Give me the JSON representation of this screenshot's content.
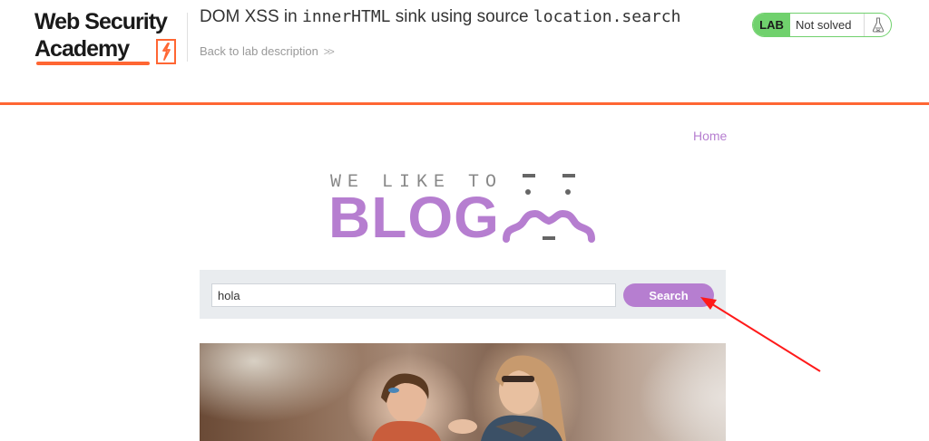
{
  "academy": {
    "logo_line1": "Web Security",
    "logo_line2": "Academy",
    "lab_title_prefix": "DOM XSS in ",
    "lab_title_code1": "innerHTML",
    "lab_title_middle": " sink using source ",
    "lab_title_code2": "location.search",
    "back_link": "Back to lab description",
    "back_link_icon": "double-chevron-right-icon",
    "status_badge": "LAB",
    "status_text": "Not solved",
    "status_icon": "flask-icon",
    "accent_color": "#ff6633",
    "status_color": "#70d16d"
  },
  "blog": {
    "nav_home": "Home",
    "banner_small": "WE LIKE TO",
    "banner_big": "BLOG",
    "brand_color": "#b67ed0",
    "search": {
      "value": "hola",
      "button_label": "Search"
    },
    "post_image_alt": ""
  }
}
